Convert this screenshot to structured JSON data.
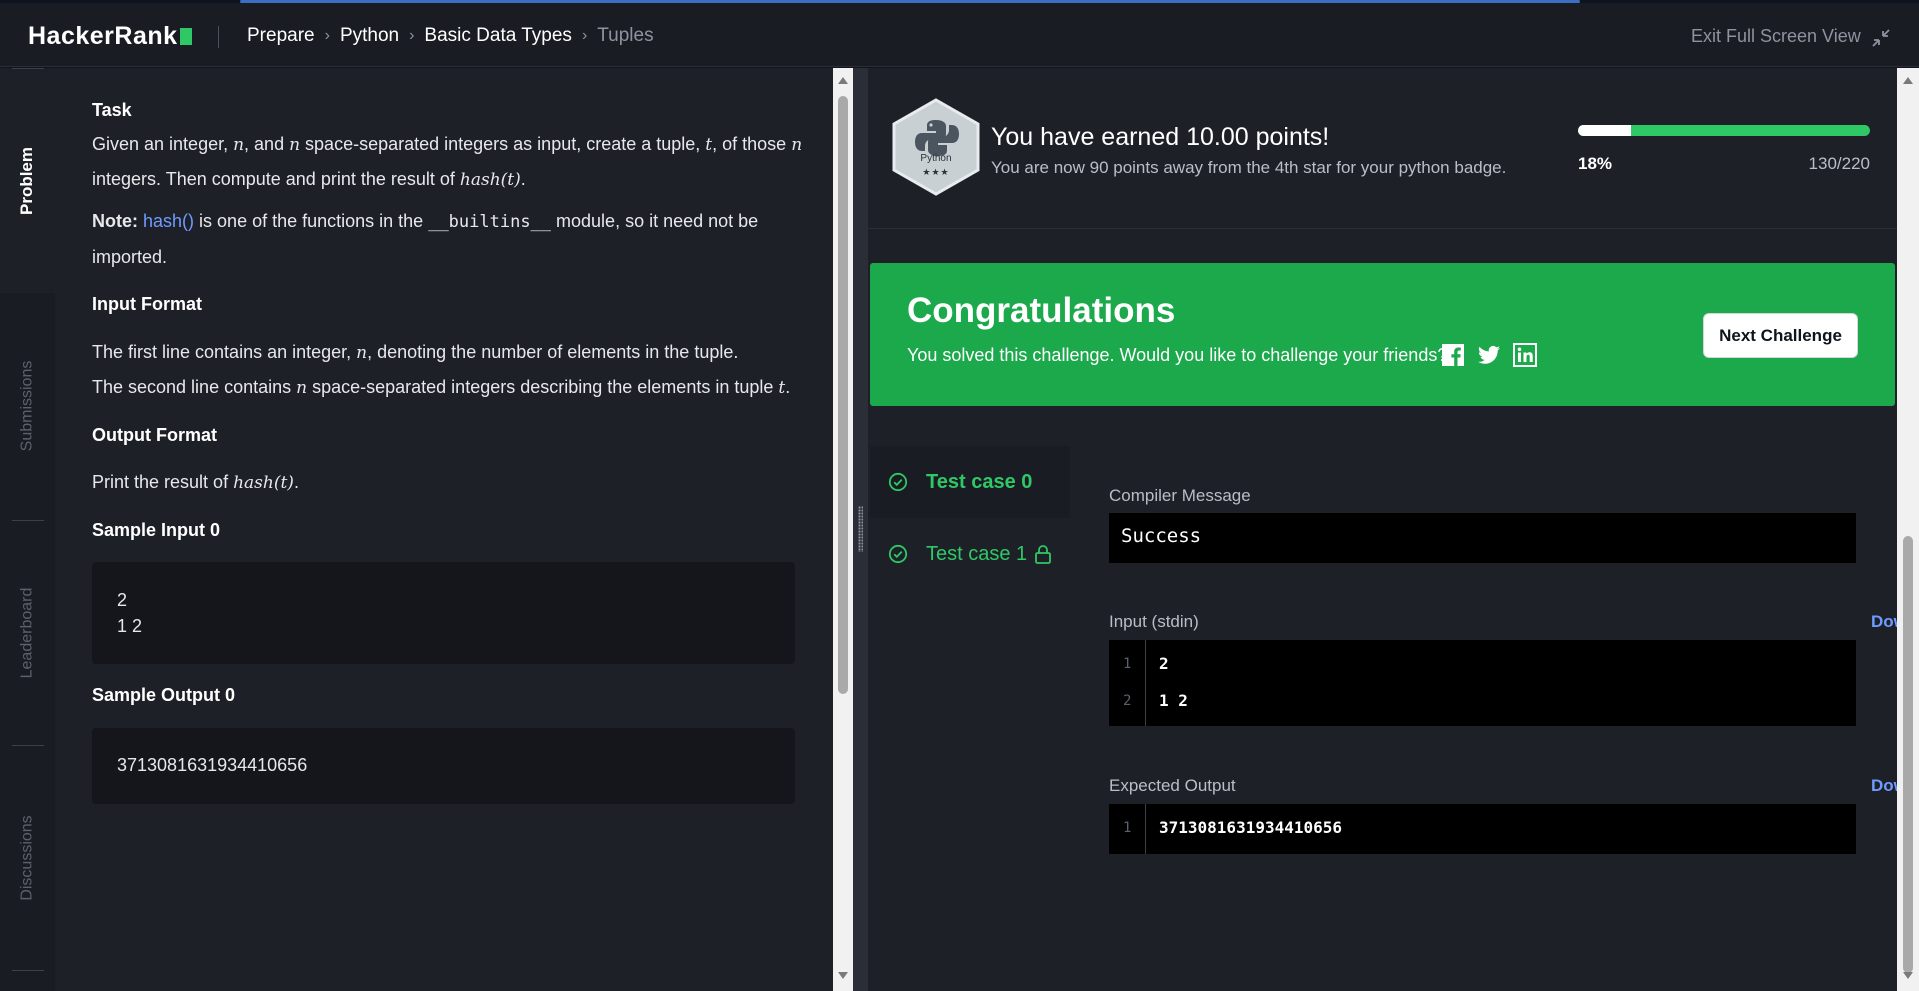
{
  "app": {
    "logo": "HackerRank",
    "breadcrumbs": [
      "Prepare",
      "Python",
      "Basic Data Types",
      "Tuples"
    ],
    "exit_label": "Exit Full Screen View"
  },
  "side_tabs": [
    "Problem",
    "Submissions",
    "Leaderboard",
    "Discussions"
  ],
  "problem": {
    "task_heading": "Task",
    "task_line1": {
      "a": "Given an integer, ",
      "n1": "n",
      "b": ", and ",
      "n2": "n",
      "c": " space-separated integers as input, create a tuple, ",
      "t": "t",
      "d": ", of those ",
      "n3": "n"
    },
    "task_line2": {
      "a": "integers. Then compute and print the result of ",
      "expr": "hash(t)",
      "b": "."
    },
    "note": {
      "label": "Note:",
      "link": "hash()",
      "a": " is one of the functions in the ",
      "module": "__builtins__",
      "b": " module, so it need not be",
      "c": "imported."
    },
    "input_heading": "Input Format",
    "input_line1": {
      "a": "The first line contains an integer, ",
      "n": "n",
      "b": ", denoting the number of elements in the tuple."
    },
    "input_line2": {
      "a": "The second line contains ",
      "n": "n",
      "b": " space-separated integers describing the elements in tuple ",
      "t": "t",
      "c": "."
    },
    "output_heading": "Output Format",
    "output_line": {
      "a": "Print the result of ",
      "expr": "hash(t)",
      "b": "."
    },
    "sample_input_heading": "Sample Input 0",
    "sample_input": [
      "2",
      "1 2"
    ],
    "sample_output_heading": "Sample Output 0",
    "sample_output": "3713081631934410656"
  },
  "results": {
    "badge_label": "Python",
    "badge_stars": "★★★",
    "earned": "You have earned 10.00 points!",
    "away": "You are now 90 points away from the 4th star for your python badge.",
    "progress_fraction": 0.18,
    "progress_pct": "18%",
    "progress_points": "130/220",
    "congrats_title": "Congratulations",
    "congrats_sub": "You solved this challenge. Would you like to challenge your friends?",
    "next_button": "Next Challenge",
    "test_cases": [
      "Test case 0",
      "Test case 1"
    ],
    "compiler_label": "Compiler Message",
    "compiler_message": "Success",
    "input_label": "Input (stdin)",
    "download": "Download",
    "input_lines": [
      {
        "num": "1",
        "text": "2"
      },
      {
        "num": "2",
        "text": "1 2"
      }
    ],
    "expected_label": "Expected Output",
    "expected_lines": [
      {
        "num": "1",
        "text": "3713081631934410656"
      }
    ]
  },
  "colors": {
    "accent": "#2ec866",
    "link": "#6f9bff",
    "congrats_bg": "#1ba94c",
    "header_bg": "#1a1c23"
  },
  "icons": [
    "exit-fullscreen-icon",
    "python-badge-icon",
    "facebook-icon",
    "twitter-icon",
    "linkedin-icon",
    "check-circle-icon",
    "lock-icon"
  ]
}
